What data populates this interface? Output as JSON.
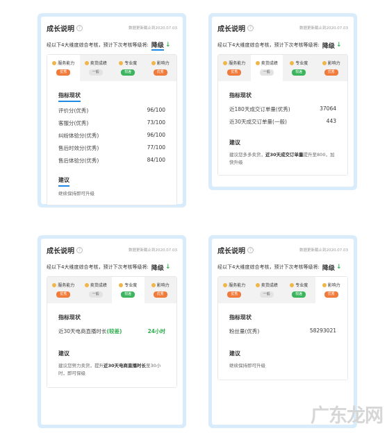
{
  "common": {
    "title": "成长说明",
    "info_icon": "?",
    "date": "数据更新截止到2020.07.03",
    "assess_text": "经以下4大维度综合考核，预计下次考核等级将:",
    "grade": "降级",
    "arrow": "↓",
    "section_metrics": "指标现状",
    "section_advice": "建议",
    "tabs": [
      {
        "name": "服务能力",
        "badge": "优秀"
      },
      {
        "name": "卖货成绩",
        "badge": "一般"
      },
      {
        "name": "专业度",
        "badge": "较差"
      },
      {
        "name": "影响力",
        "badge": "优秀"
      }
    ]
  },
  "cards": [
    {
      "metrics": [
        {
          "label": "评价分(优秀)",
          "value": "96/100"
        },
        {
          "label": "客服分(优秀)",
          "value": "73/100"
        },
        {
          "label": "纠纷体验分(优秀)",
          "value": "96/100"
        },
        {
          "label": "售后时效分(优秀)",
          "value": "77/100"
        },
        {
          "label": "售后体验分(优秀)",
          "value": "84/100"
        }
      ],
      "advice": "继续保持即可升级"
    },
    {
      "metrics": [
        {
          "label": "近180天成交订单量(优秀)",
          "value": "37064"
        },
        {
          "label": "近30天成交订单量(一般)",
          "value": "443"
        }
      ],
      "advice_parts": [
        "建议您多多卖货，",
        "近30天成交订单量",
        "提升至800，加快升级"
      ]
    },
    {
      "metric_label_a": "近30天电商直播时长",
      "metric_label_b": "(较差)",
      "metric_value": "24小时",
      "advice_parts": [
        "建议您努力卖货，提升",
        "近30天电商直播时长",
        "至30小时，即可保级"
      ]
    },
    {
      "metrics": [
        {
          "label": "粉丝量(优秀)",
          "value": "58293021"
        }
      ],
      "advice": "继续保持即可升级"
    }
  ],
  "watermark": "广东龙网",
  "colors": {
    "accent": "#1e88e5",
    "panel": "#d9ecfb",
    "orange": "#f07b3a",
    "green": "#3cb55d"
  }
}
